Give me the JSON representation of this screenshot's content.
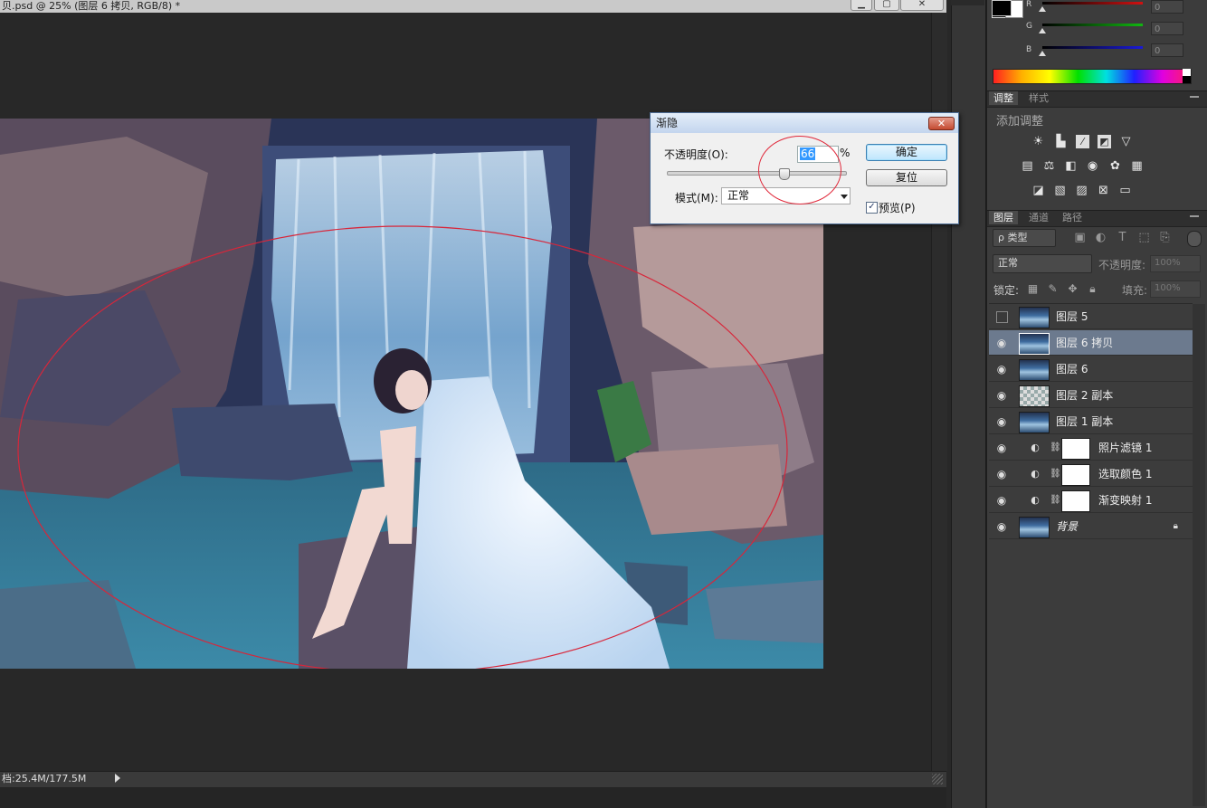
{
  "document": {
    "title": "贝.psd @ 25% (图层 6 拷贝, RGB/8) *",
    "window_buttons": [
      "▁",
      "▢",
      "✕"
    ],
    "status": "档:25.4M/177.5M"
  },
  "color_panel": {
    "channels": [
      {
        "label": "R",
        "value": "0",
        "color": "#d11111"
      },
      {
        "label": "G",
        "value": "0",
        "color": "#11b711"
      },
      {
        "label": "B",
        "value": "0",
        "color": "#1a1ad6"
      }
    ]
  },
  "adjustments_panel": {
    "tabs": [
      "调整",
      "样式"
    ],
    "heading": "添加调整",
    "icon_rows": [
      [
        "brightness-icon",
        "levels-icon",
        "curves-icon",
        "exposure-icon",
        "vibrance-icon"
      ],
      [
        "hue-saturation-icon",
        "color-balance-icon",
        "black-white-icon",
        "photo-filter-icon",
        "channel-mixer-icon",
        "color-lookup-icon"
      ],
      [
        "invert-icon",
        "posterize-icon",
        "threshold-icon",
        "selective-color-icon",
        "gradient-map-icon"
      ]
    ]
  },
  "layers_panel": {
    "tabs": [
      "图层",
      "通道",
      "路径"
    ],
    "filter_kind": "ρ 类型",
    "blend_mode": "正常",
    "opacity_label": "不透明度:",
    "opacity_value": "100%",
    "lock_label": "锁定:",
    "fill_label": "填充:",
    "fill_value": "100%",
    "layers": [
      {
        "name": "图层 5",
        "visible": false,
        "type": "photo",
        "selected": false
      },
      {
        "name": "图层 6 拷贝",
        "visible": true,
        "type": "photo",
        "selected": true
      },
      {
        "name": "图层 6",
        "visible": true,
        "type": "photo",
        "selected": false
      },
      {
        "name": "图层 2 副本",
        "visible": true,
        "type": "transparent",
        "selected": false
      },
      {
        "name": "图层 1 副本",
        "visible": true,
        "type": "photo",
        "selected": false
      },
      {
        "name": "照片滤镜 1",
        "visible": true,
        "type": "adjustment",
        "selected": false
      },
      {
        "name": "选取颜色 1",
        "visible": true,
        "type": "adjustment",
        "selected": false
      },
      {
        "name": "渐变映射 1",
        "visible": true,
        "type": "adjustment",
        "selected": false
      },
      {
        "name": "背景",
        "visible": true,
        "type": "background",
        "selected": false,
        "locked": true
      }
    ]
  },
  "fade_dialog": {
    "title": "渐隐",
    "close": "✕",
    "opacity_label": "不透明度(O):",
    "opacity_value": "66",
    "opacity_unit": "%",
    "opacity_fraction": 0.66,
    "mode_label": "模式(M):",
    "mode_value": "正常",
    "ok": "确定",
    "reset": "复位",
    "preview_label": "预览(P)",
    "preview_checked": true
  }
}
